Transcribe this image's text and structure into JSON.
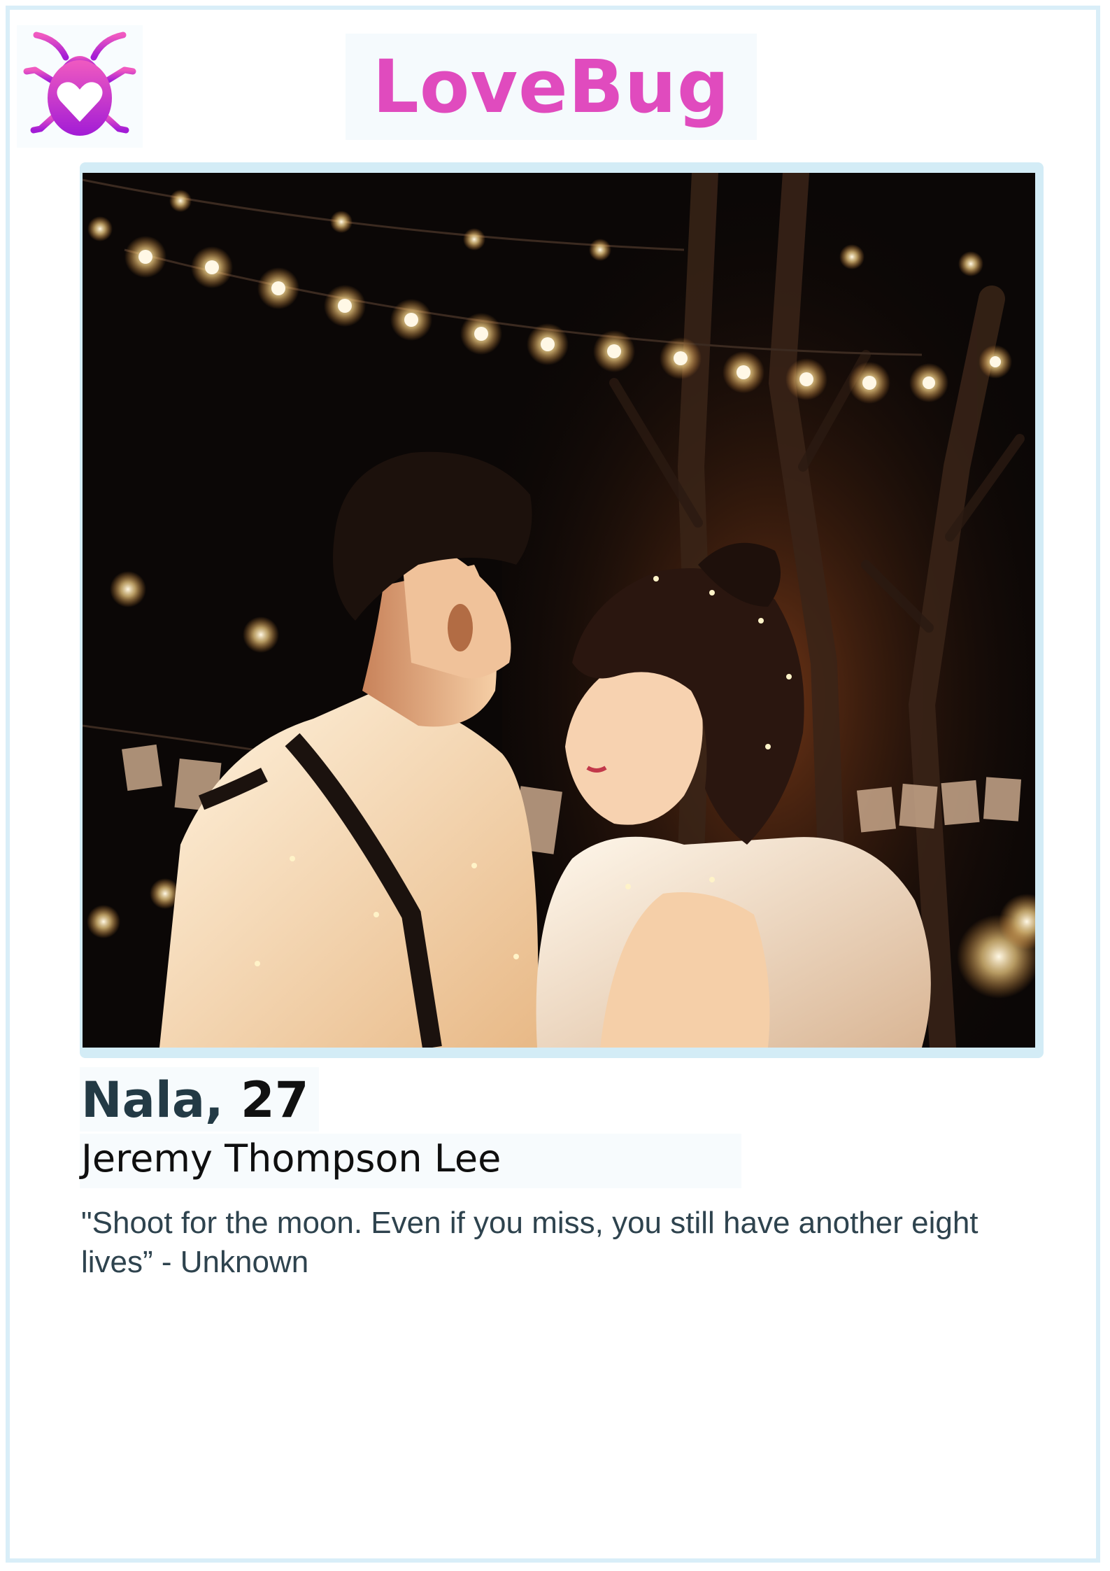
{
  "app": {
    "brand_name": "LoveBug",
    "logo_icon": "heart-bug-icon",
    "brand_color": "#e04bbe"
  },
  "profile": {
    "name": "Nala,",
    "age": "27",
    "subtitle": "Jeremy Thompson Lee",
    "quote": "\"Shoot for the moon. Even if you miss, you still have another eight lives” - Unknown",
    "photo_icon": "couple-photo"
  },
  "colors": {
    "frame": "#d9eef8",
    "name_text": "#233a45",
    "quote_text": "#2e434e"
  }
}
